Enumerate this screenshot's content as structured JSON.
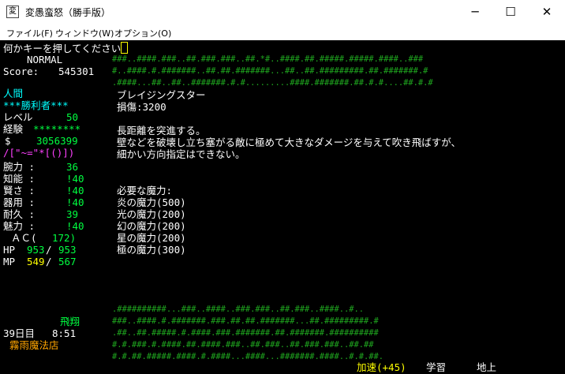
{
  "window": {
    "title": "変愚蛮怒（勝手版）",
    "icon": "変",
    "min": "─",
    "max": "☐",
    "close": "✕"
  },
  "menu": [
    "ファイル(F)",
    "ウィンドウ(W)",
    "オプション(O)"
  ],
  "prompt": "何かキーを押してください",
  "mode": "NORMAL",
  "score_label": "Score:",
  "score_value": "545301",
  "race": "人間",
  "title": "***勝利者***",
  "level_label": "レベル",
  "level_value": "50",
  "exp_label": "経験",
  "exp_value": "********",
  "gold_label": "$",
  "gold_value": "3056399",
  "equip": "/[\"~=\"*[()])",
  "stats": [
    {
      "label": "腕力 :",
      "value": "36"
    },
    {
      "label": "知能 :",
      "value": "!40"
    },
    {
      "label": "賢さ :",
      "value": "!40"
    },
    {
      "label": "器用 :",
      "value": "!40"
    },
    {
      "label": "耐久 :",
      "value": "39"
    },
    {
      "label": "魅力 :",
      "value": "!40"
    }
  ],
  "ac_label": "ＡＣ(",
  "ac_value": "172)",
  "hp_label": "HP",
  "hp_cur": "953",
  "hp_max": "953",
  "mp_label": "MP",
  "mp_cur": "549",
  "mp_max": "567",
  "flying": "飛翔",
  "day": "39日目",
  "time": "8:51",
  "location": "霧雨魔法店",
  "speed": "加速(+45)",
  "study": "学習",
  "depth": "地上",
  "info": {
    "name": "ブレイジングスター",
    "damage": "損傷:3200",
    "desc1": "長距離を突進する。",
    "desc2": "壁などを破壊し立ち塞がる敵に極めて大きなダメージを与えて吹き飛ばすが、",
    "desc3": "細かい方向指定はできない。",
    "req_header": "必要な魔力:",
    "reqs": [
      "炎の魔力(500)",
      "光の魔力(200)",
      "幻の魔力(200)",
      "星の魔力(200)",
      "極の魔力(300)"
    ]
  },
  "map_top": [
    "###..####.###..##.###.###..##.*#..####.##.#####.#####.####..###",
    "#..####.#.#######..##.##.#######...##..##.#########.##.#######.#",
    ".####...##..##..#######.#.#.........####.#######.##.#.#....##.#.#"
  ],
  "map_bottom": [
    ".##########...###..####..###.###..##.###..####..#..",
    "###..####.#.#######.###.##.##.#######...##.#########.#",
    ".##..##.#####.#.####.###.#######.##.#######.##########",
    "#.#.###.#.####.##.####.###..##.###..##.###.###..##.##",
    "#.#.##.#####.####.#.####...####...#######.####..#.#.##."
  ]
}
